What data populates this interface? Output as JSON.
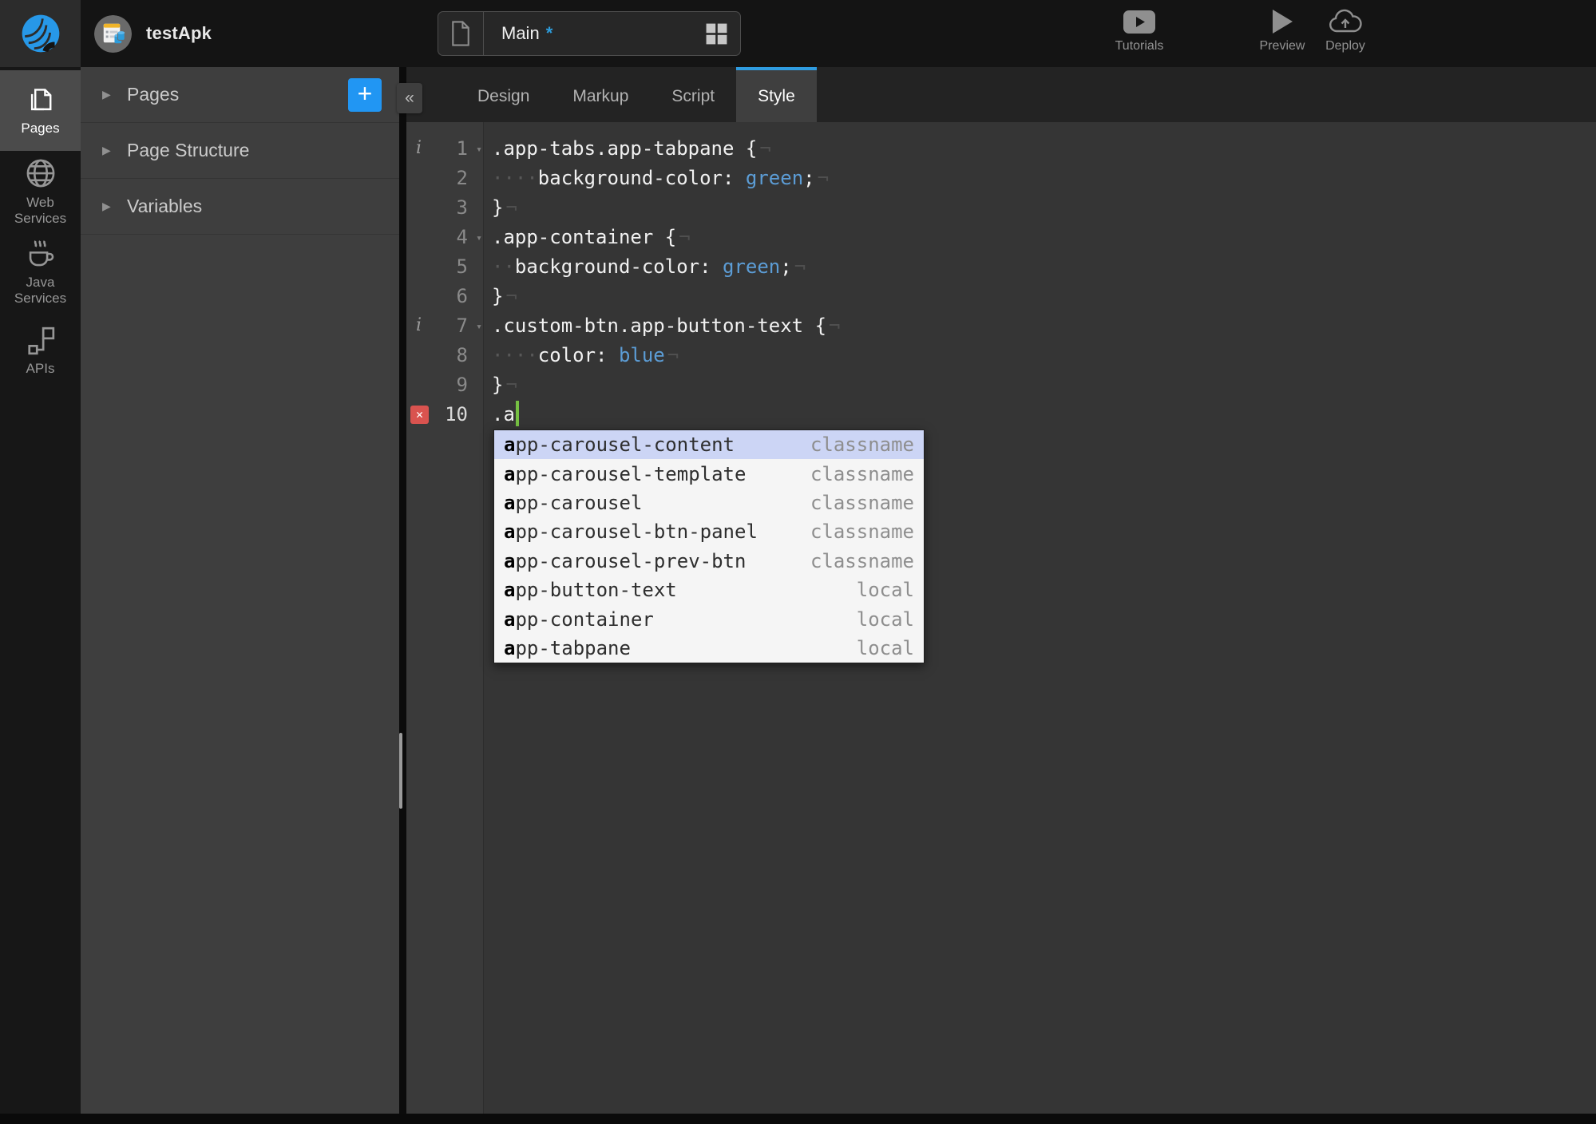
{
  "topbar": {
    "project_name": "testApk",
    "page_tab": {
      "name": "Main",
      "dirty_marker": "*"
    },
    "actions": [
      {
        "name": "tutorials",
        "label": "Tutorials",
        "icon": "youtube-icon"
      },
      {
        "name": "preview",
        "label": "Preview",
        "icon": "play-icon"
      },
      {
        "name": "deploy",
        "label": "Deploy",
        "icon": "cloud-upload-icon"
      }
    ]
  },
  "sidebar": {
    "items": [
      {
        "label": "Pages",
        "icon": "pages-icon",
        "active": true
      },
      {
        "label": "Web\nServices",
        "icon": "globe-icon",
        "active": false
      },
      {
        "label": "Java\nServices",
        "icon": "coffee-icon",
        "active": false
      },
      {
        "label": "APIs",
        "icon": "api-icon",
        "active": false
      }
    ]
  },
  "panel": {
    "sections": [
      {
        "label": "Pages",
        "has_add": true
      },
      {
        "label": "Page Structure",
        "has_add": false
      },
      {
        "label": "Variables",
        "has_add": false
      }
    ]
  },
  "icons": {
    "plus": "+",
    "collapse": "«",
    "section_caret": "▶",
    "fold_caret": "▾",
    "error_glyph": "✕",
    "info_glyph": "i",
    "eol_glyph": "¬",
    "space_glyph": "·"
  },
  "editor": {
    "tabs": [
      {
        "label": "Design",
        "active": false
      },
      {
        "label": "Markup",
        "active": false
      },
      {
        "label": "Script",
        "active": false
      },
      {
        "label": "Style",
        "active": true
      }
    ],
    "code": {
      "lines": [
        {
          "num": "1",
          "info": true,
          "error": false,
          "fold": true,
          "current": false,
          "eol": true,
          "segments": [
            {
              "style": "code",
              "text": ".app-tabs.app-tabpane {"
            }
          ]
        },
        {
          "num": "2",
          "info": false,
          "error": false,
          "fold": false,
          "current": false,
          "eol": true,
          "segments": [
            {
              "style": "ws",
              "spaces": 4
            },
            {
              "style": "code",
              "text": "background-color: "
            },
            {
              "style": "value",
              "text": "green"
            },
            {
              "style": "code",
              "text": ";"
            }
          ]
        },
        {
          "num": "3",
          "info": false,
          "error": false,
          "fold": false,
          "current": false,
          "eol": true,
          "segments": [
            {
              "style": "code",
              "text": "}"
            }
          ]
        },
        {
          "num": "4",
          "info": false,
          "error": false,
          "fold": true,
          "current": false,
          "eol": true,
          "segments": [
            {
              "style": "code",
              "text": ".app-container {"
            }
          ]
        },
        {
          "num": "5",
          "info": false,
          "error": false,
          "fold": false,
          "current": false,
          "eol": true,
          "segments": [
            {
              "style": "ws",
              "spaces": 2
            },
            {
              "style": "code",
              "text": "background-color: "
            },
            {
              "style": "value",
              "text": "green"
            },
            {
              "style": "code",
              "text": ";"
            }
          ]
        },
        {
          "num": "6",
          "info": false,
          "error": false,
          "fold": false,
          "current": false,
          "eol": true,
          "segments": [
            {
              "style": "code",
              "text": "}"
            }
          ]
        },
        {
          "num": "7",
          "info": true,
          "error": false,
          "fold": true,
          "current": false,
          "eol": true,
          "segments": [
            {
              "style": "code",
              "text": ".custom-btn.app-button-text {"
            }
          ]
        },
        {
          "num": "8",
          "info": false,
          "error": false,
          "fold": false,
          "current": false,
          "eol": true,
          "segments": [
            {
              "style": "ws",
              "spaces": 4
            },
            {
              "style": "code",
              "text": "color: "
            },
            {
              "style": "value",
              "text": "blue"
            }
          ]
        },
        {
          "num": "9",
          "info": false,
          "error": false,
          "fold": false,
          "current": false,
          "eol": true,
          "segments": [
            {
              "style": "code",
              "text": "}"
            }
          ]
        },
        {
          "num": "10",
          "info": false,
          "error": true,
          "fold": false,
          "current": true,
          "eol": false,
          "cursor": true,
          "segments": [
            {
              "style": "code",
              "text": ".a"
            }
          ]
        }
      ]
    },
    "autocomplete": {
      "items": [
        {
          "match": "a",
          "rest": "pp-carousel-content",
          "kind": "classname",
          "selected": true
        },
        {
          "match": "a",
          "rest": "pp-carousel-template",
          "kind": "classname",
          "selected": false
        },
        {
          "match": "a",
          "rest": "pp-carousel",
          "kind": "classname",
          "selected": false
        },
        {
          "match": "a",
          "rest": "pp-carousel-btn-panel",
          "kind": "classname",
          "selected": false
        },
        {
          "match": "a",
          "rest": "pp-carousel-prev-btn",
          "kind": "classname",
          "selected": false
        },
        {
          "match": "a",
          "rest": "pp-button-text",
          "kind": "local",
          "selected": false
        },
        {
          "match": "a",
          "rest": "pp-container",
          "kind": "local",
          "selected": false
        },
        {
          "match": "a",
          "rest": "pp-tabpane",
          "kind": "local",
          "selected": false
        }
      ]
    }
  },
  "colors": {
    "accent": "#2196f3",
    "tab_accent": "#2f9ce0",
    "value_blue": "#5c9dd6",
    "cursor_green": "#76c043",
    "error_red": "#d9534f",
    "autocomplete_select_bg": "#ccd5f5",
    "logo_blue": "#2798e8",
    "dirty_star_blue": "#2d9cdb"
  }
}
